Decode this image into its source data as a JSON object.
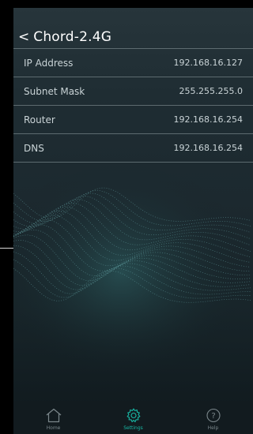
{
  "header": {
    "back_glyph": "<",
    "title": "Chord-2.4G"
  },
  "network_info": {
    "rows": [
      {
        "label": "IP Address",
        "value": "192.168.16.127"
      },
      {
        "label": "Subnet Mask",
        "value": "255.255.255.0"
      },
      {
        "label": "Router",
        "value": "192.168.16.254"
      },
      {
        "label": "DNS",
        "value": "192.168.16.254"
      }
    ]
  },
  "tabbar": {
    "tabs": [
      {
        "label": "Home",
        "icon": "home-icon",
        "active": false
      },
      {
        "label": "Settings",
        "icon": "gear-icon",
        "active": true
      },
      {
        "label": "Help",
        "icon": "help-icon",
        "active": false
      }
    ]
  },
  "colors": {
    "accent": "#18b9a6",
    "background": "#1f2d33",
    "divider": "#5d6b70",
    "tabbar": "#121b1f"
  }
}
